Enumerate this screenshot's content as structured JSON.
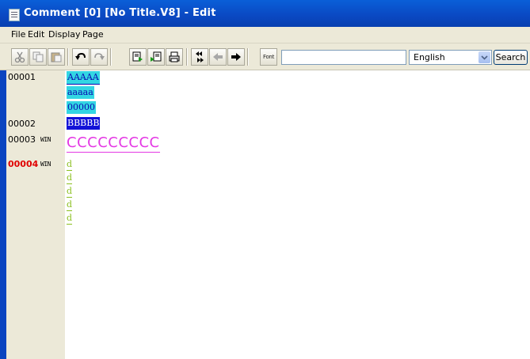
{
  "window": {
    "title": "Comment [0] [No Title.V8] - Edit"
  },
  "menu": {
    "items": [
      "File",
      "Edit",
      "Display",
      "Page"
    ]
  },
  "toolbar": {
    "buttons": [
      {
        "name": "cut-icon"
      },
      {
        "name": "copy-icon"
      },
      {
        "name": "paste-icon"
      },
      {
        "name": "undo-icon"
      },
      {
        "name": "redo-icon"
      },
      {
        "name": "export-icon"
      },
      {
        "name": "import-icon"
      },
      {
        "name": "print-icon"
      },
      {
        "name": "rewind-icon"
      },
      {
        "name": "back-arrow-icon"
      },
      {
        "name": "forward-arrow-icon"
      },
      {
        "name": "font-icon"
      }
    ],
    "font_label": "Font",
    "search_value": "",
    "language_selected": "English",
    "search_label": "Search"
  },
  "editor": {
    "rows": [
      {
        "line": "00001",
        "win": "",
        "entries": [
          "AAAAA",
          "aaaaa",
          "00000"
        ]
      },
      {
        "line": "00002",
        "win": "",
        "entries": [
          "BBBBB"
        ]
      },
      {
        "line": "00003",
        "win": "WIN",
        "entries": [
          "CCCCCCCCC"
        ]
      },
      {
        "line": "00004",
        "win": "WIN",
        "entries": [
          "d",
          "d",
          "d",
          "d",
          "d"
        ],
        "active": true
      }
    ]
  },
  "colors": {
    "titlebar": "#0a48c2",
    "cyan_cell": "#33d6e3",
    "blue_cell": "#1212d8",
    "magenta_text": "#e437e4",
    "green_text": "#8abf1e",
    "active_line": "#e00000"
  }
}
